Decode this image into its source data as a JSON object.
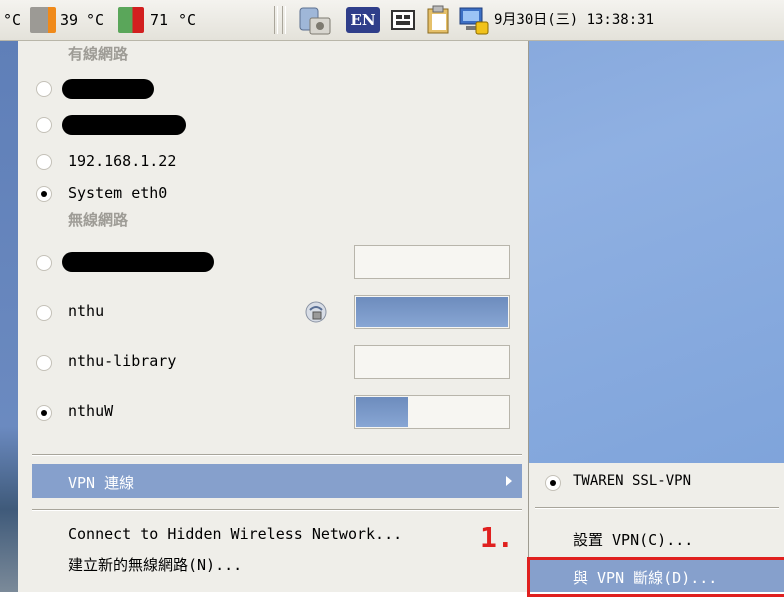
{
  "panel": {
    "temp1_unit": "°C",
    "temp2_value": "39",
    "temp2_unit": "°C",
    "temp3_value": "71",
    "temp3_unit": "°C",
    "input_method": "EN",
    "clock": "9月30日(三) 13:38:31"
  },
  "menu": {
    "wired_heading": "有線網路",
    "wired_items": [
      {
        "label": "",
        "selected": false,
        "redacted": true
      },
      {
        "label": "",
        "selected": false,
        "redacted": true
      },
      {
        "label": "192.168.1.22",
        "selected": false
      },
      {
        "label": "System eth0",
        "selected": true
      }
    ],
    "wireless_heading": "無線網路",
    "wireless_items": [
      {
        "label": "",
        "selected": false,
        "redacted": true,
        "signal": 0.0
      },
      {
        "label": "nthu",
        "selected": false,
        "secured": true,
        "signal": 1.0
      },
      {
        "label": "nthu-library",
        "selected": false,
        "signal": 0.0
      },
      {
        "label": "nthuW",
        "selected": true,
        "signal": 0.35
      }
    ],
    "vpn_label": "VPN 連線",
    "hidden_network": "Connect to Hidden Wireless Network...",
    "new_network": "建立新的無線網路(N)..."
  },
  "submenu": {
    "vpn_name": "TWAREN SSL-VPN",
    "configure": "設置 VPN(C)...",
    "disconnect": "與 VPN 斷線(D)..."
  },
  "annotation": {
    "step": "1."
  }
}
